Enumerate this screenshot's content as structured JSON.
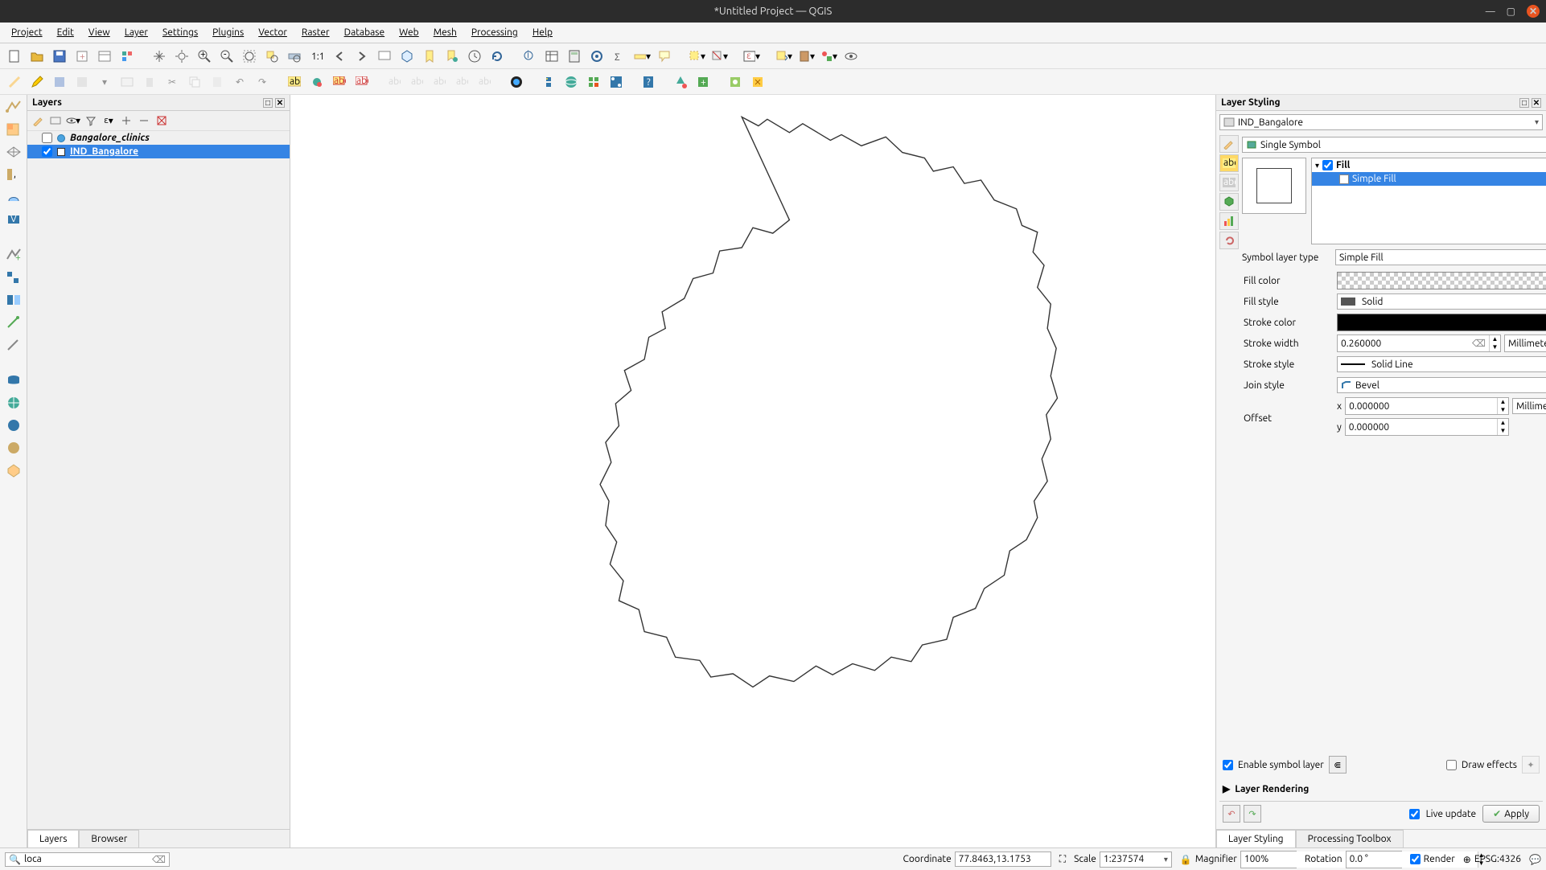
{
  "title": "*Untitled Project — QGIS",
  "menu": [
    "Project",
    "Edit",
    "View",
    "Layer",
    "Settings",
    "Plugins",
    "Vector",
    "Raster",
    "Database",
    "Web",
    "Mesh",
    "Processing",
    "Help"
  ],
  "layers_panel": {
    "title": "Layers",
    "items": [
      {
        "checked": false,
        "name": "Bangalore_clinics",
        "italic": true,
        "selected": false,
        "sym_color": "#4aa3df"
      },
      {
        "checked": true,
        "name": "IND_Bangalore",
        "italic": false,
        "selected": true,
        "underline": true,
        "sym_color": "#ffffff"
      }
    ],
    "tabs": [
      "Layers",
      "Browser"
    ],
    "active_tab": 0
  },
  "styling": {
    "title": "Layer Styling",
    "layer_selector": "IND_Bangalore",
    "renderer": "Single Symbol",
    "tree_root": "Fill",
    "tree_child": "Simple Fill",
    "symbol_layer_type_label": "Symbol layer type",
    "symbol_layer_type": "Simple Fill",
    "props": {
      "fill_color_label": "Fill color",
      "fill_style_label": "Fill style",
      "fill_style": "Solid",
      "stroke_color_label": "Stroke color",
      "stroke_width_label": "Stroke width",
      "stroke_width": "0.260000",
      "stroke_width_unit": "Millimeters",
      "stroke_style_label": "Stroke style",
      "stroke_style": "Solid Line",
      "join_style_label": "Join style",
      "join_style": "Bevel",
      "offset_label": "Offset",
      "offset_x_label": "x",
      "offset_x": "0.000000",
      "offset_y_label": "y",
      "offset_y": "0.000000",
      "offset_unit": "Millimeters"
    },
    "enable_symbol_layer": "Enable symbol layer",
    "draw_effects": "Draw effects",
    "layer_rendering": "Layer Rendering",
    "live_update": "Live update",
    "apply": "Apply",
    "bottom_tabs": [
      "Layer Styling",
      "Processing Toolbox"
    ],
    "active_bottom_tab": 0
  },
  "statusbar": {
    "search": "loca",
    "coordinate_label": "Coordinate",
    "coordinate": "77.8463,13.1753",
    "scale_label": "Scale",
    "scale": "1:237574",
    "magnifier_label": "Magnifier",
    "magnifier": "100%",
    "rotation_label": "Rotation",
    "rotation": "0.0 °",
    "render": "Render",
    "crs": "EPSG:4326"
  }
}
